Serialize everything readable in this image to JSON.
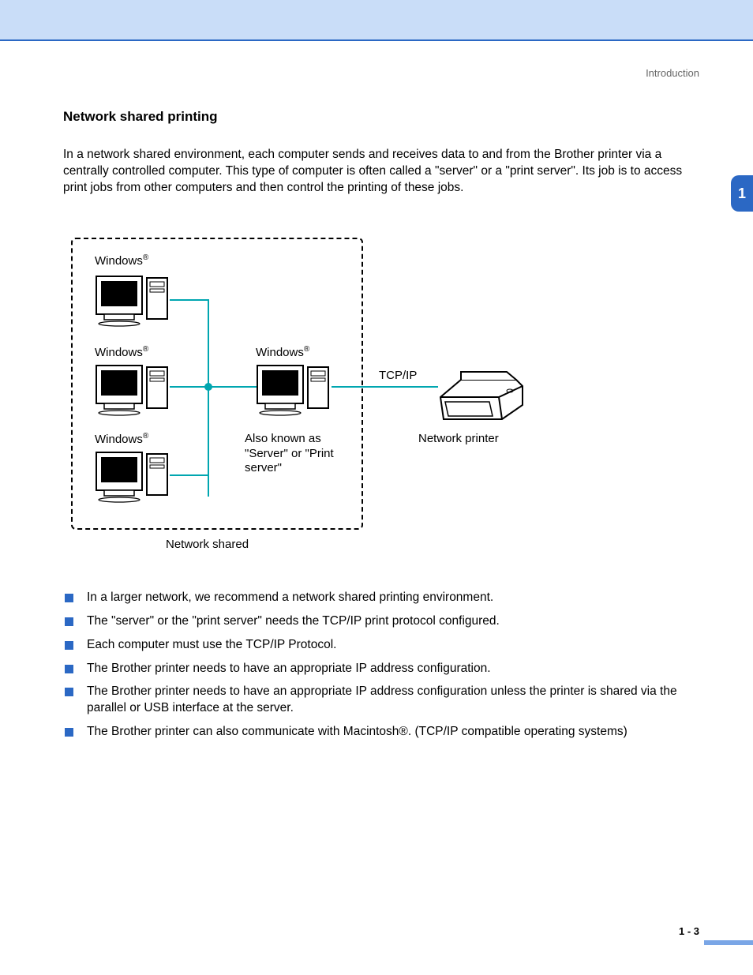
{
  "header": {
    "chapter": "Introduction",
    "tab": "1"
  },
  "section": {
    "heading": "Network shared printing"
  },
  "intro": "In a network shared environment, each computer sends and receives data to and from the Brother printer via a centrally controlled computer. This type of computer is often called a \"server\" or a \"print server\". Its job is to access print jobs from other computers and then control the printing of these jobs.",
  "diagram": {
    "client1": "Windows",
    "client2": "Windows",
    "client3": "Windows",
    "server": "Windows",
    "server_sub": "Also known as \"Server\" or \"Print server\"",
    "group_label": "Network shared",
    "link_label": "TCP/IP",
    "printer_label": "Network printer"
  },
  "bullets": [
    "In a larger network, we recommend a network shared printing environment.",
    "The \"server\" or the \"print server\" needs the TCP/IP print protocol configured.",
    "Each computer must use the TCP/IP Protocol.",
    "The Brother printer needs to have an appropriate IP address configuration.",
    "The Brother printer needs to have an appropriate IP address configuration unless the printer is shared via the parallel or USB interface at the server.",
    "The Brother printer can also communicate with Macintosh®. (TCP/IP compatible operating systems)"
  ],
  "footer": {
    "page": "1 - 3"
  }
}
